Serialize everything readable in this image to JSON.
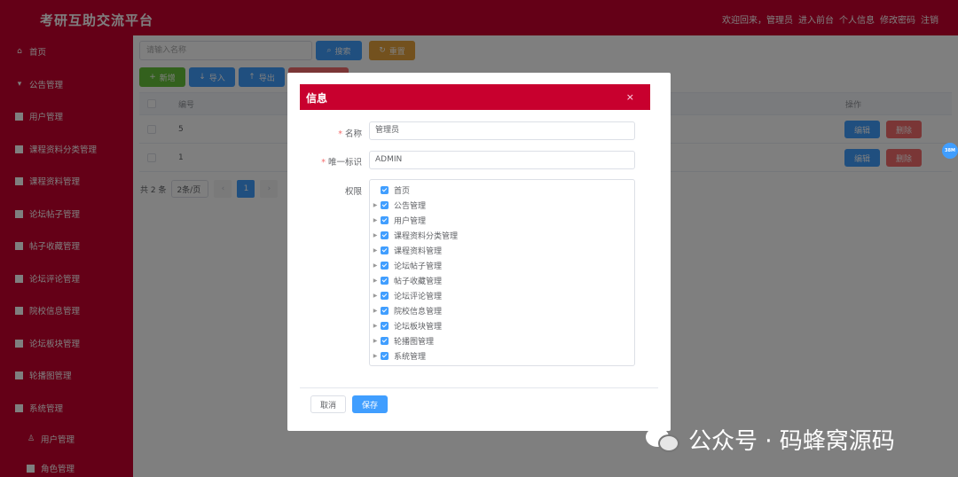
{
  "header": {
    "title": "考研互助交流平台",
    "welcome": "欢迎回来，管理员",
    "links": [
      "进入前台",
      "个人信息",
      "修改密码",
      "注销"
    ]
  },
  "sidebar": {
    "items": [
      {
        "label": "首页",
        "icon": "home-icon"
      },
      {
        "label": "公告管理",
        "icon": "message-icon"
      },
      {
        "label": "用户管理",
        "icon": "grid-icon"
      },
      {
        "label": "课程资料分类管理",
        "icon": "grid-icon"
      },
      {
        "label": "课程资料管理",
        "icon": "grid-icon"
      },
      {
        "label": "论坛帖子管理",
        "icon": "grid-icon"
      },
      {
        "label": "帖子收藏管理",
        "icon": "grid-icon"
      },
      {
        "label": "论坛评论管理",
        "icon": "grid-icon"
      },
      {
        "label": "院校信息管理",
        "icon": "grid-icon"
      },
      {
        "label": "论坛板块管理",
        "icon": "grid-icon"
      },
      {
        "label": "轮播图管理",
        "icon": "grid-icon"
      },
      {
        "label": "系统管理",
        "icon": "grid-icon"
      }
    ],
    "sub_items": [
      {
        "label": "用户管理",
        "icon": "user-icon"
      },
      {
        "label": "角色管理",
        "icon": "grid-icon"
      }
    ]
  },
  "toolbar": {
    "search_placeholder": "请输入名称",
    "search_label": "搜索",
    "reset_label": "重置",
    "add_label": "新增",
    "import_label": "导入",
    "export_label": "导出"
  },
  "table": {
    "columns": [
      "编号",
      "操作"
    ],
    "rows": [
      {
        "id": "5"
      },
      {
        "id": "1"
      }
    ],
    "edit_label": "编辑",
    "delete_label": "删除"
  },
  "pagination": {
    "total": "共 2 条",
    "page_size": "2条/页",
    "current_page": "1"
  },
  "dialog": {
    "title": "信息",
    "close": "×",
    "name_label": "名称",
    "name_value": "管理员",
    "key_label": "唯一标识",
    "key_value": "ADMIN",
    "perm_label": "权限",
    "tree": [
      {
        "label": "首页",
        "has_children": false
      },
      {
        "label": "公告管理",
        "has_children": true
      },
      {
        "label": "用户管理",
        "has_children": true
      },
      {
        "label": "课程资料分类管理",
        "has_children": true
      },
      {
        "label": "课程资料管理",
        "has_children": true
      },
      {
        "label": "论坛帖子管理",
        "has_children": true
      },
      {
        "label": "帖子收藏管理",
        "has_children": true
      },
      {
        "label": "论坛评论管理",
        "has_children": true
      },
      {
        "label": "院校信息管理",
        "has_children": true
      },
      {
        "label": "论坛板块管理",
        "has_children": true
      },
      {
        "label": "轮播图管理",
        "has_children": true
      },
      {
        "label": "系统管理",
        "has_children": true
      }
    ],
    "cancel_label": "取消",
    "save_label": "保存"
  },
  "watermark": {
    "text": "公众号 · 码蜂窝源码"
  },
  "side_badge": "38M",
  "colors": {
    "brand": "#c8002e",
    "primary": "#409eff",
    "danger": "#f56c6c"
  }
}
